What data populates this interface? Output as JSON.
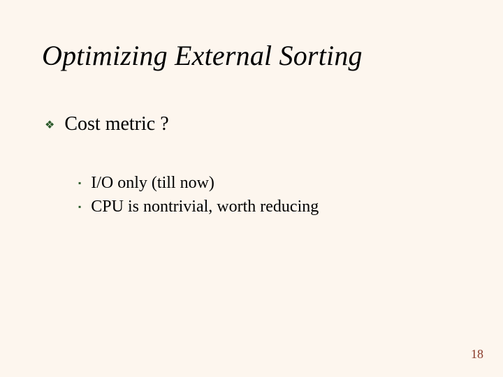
{
  "slide": {
    "title": "Optimizing External Sorting",
    "bullet1": "Cost metric ?",
    "sub1": "I/O  only (till now)",
    "sub2": "CPU is nontrivial, worth reducing",
    "page_number": "18"
  }
}
